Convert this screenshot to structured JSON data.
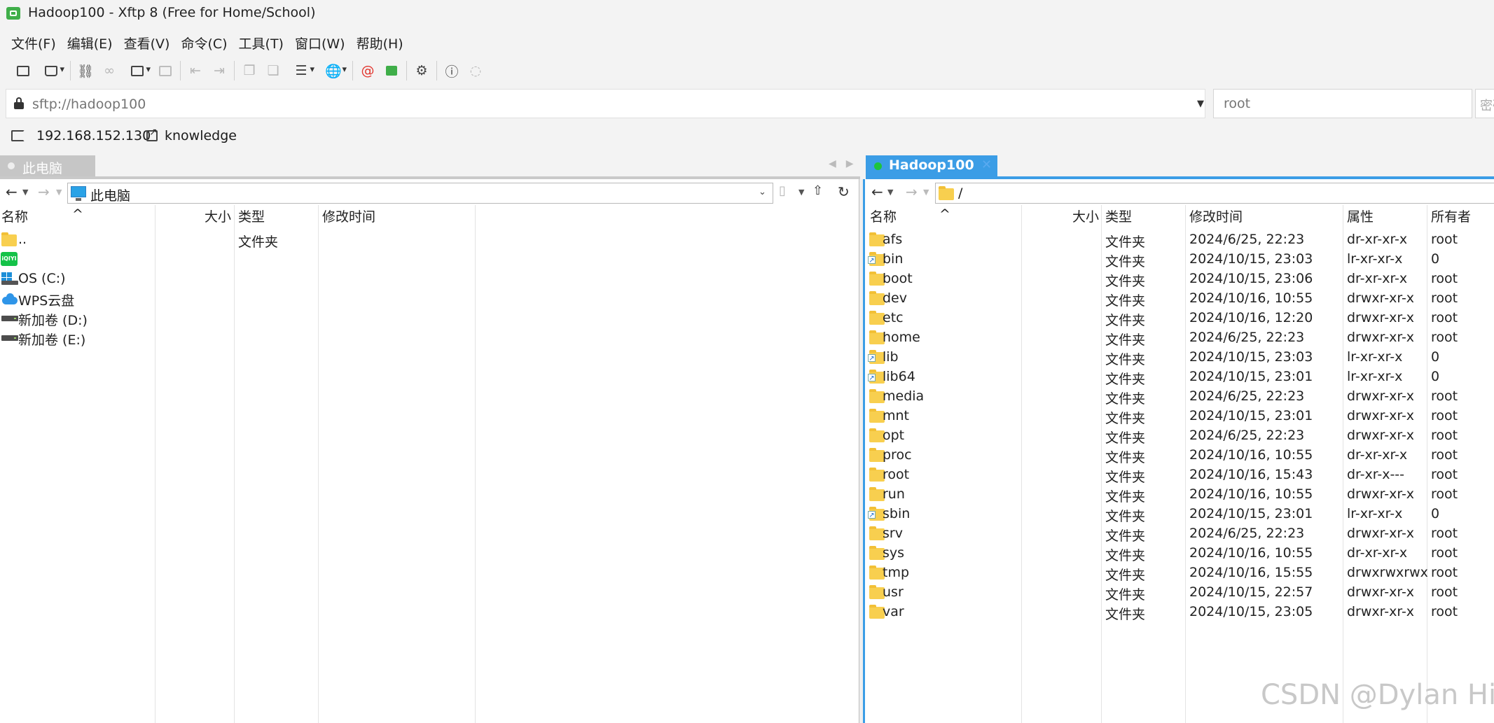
{
  "window": {
    "title": "Hadoop100 - Xftp 8 (Free for Home/School)"
  },
  "menu": [
    "文件(F)",
    "编辑(E)",
    "查看(V)",
    "命令(C)",
    "工具(T)",
    "窗口(W)",
    "帮助(H)"
  ],
  "address": {
    "url": "sftp://hadoop100",
    "username": "root",
    "password_placeholder": "密码"
  },
  "link_bar": {
    "host": "192.168.152.130",
    "session": "knowledge"
  },
  "tabs": {
    "left": "此电脑",
    "right": "Hadoop100"
  },
  "left_pane": {
    "path": "此电脑",
    "columns": [
      "名称",
      "大小",
      "类型",
      "修改时间"
    ],
    "rows": [
      {
        "name": "..",
        "type": "文件夹",
        "icon": "folder-icon"
      },
      {
        "name": "",
        "type": "",
        "icon": "iqiyi-icon"
      },
      {
        "name": "OS (C:)",
        "type": "",
        "icon": "windows-drive-icon"
      },
      {
        "name": "WPS云盘",
        "type": "",
        "icon": "cloud-icon"
      },
      {
        "name": "新加卷 (D:)",
        "type": "",
        "icon": "drive-icon"
      },
      {
        "name": "新加卷 (E:)",
        "type": "",
        "icon": "drive-icon"
      }
    ]
  },
  "right_pane": {
    "path": "/",
    "columns": [
      "名称",
      "大小",
      "类型",
      "修改时间",
      "属性",
      "所有者"
    ],
    "rows": [
      {
        "name": "afs",
        "type": "文件夹",
        "modified": "2024/6/25, 22:23",
        "attr": "dr-xr-xr-x",
        "owner": "root",
        "link": false
      },
      {
        "name": "bin",
        "type": "文件夹",
        "modified": "2024/10/15, 23:03",
        "attr": "lr-xr-xr-x",
        "owner": "0",
        "link": true
      },
      {
        "name": "boot",
        "type": "文件夹",
        "modified": "2024/10/15, 23:06",
        "attr": "dr-xr-xr-x",
        "owner": "root",
        "link": false
      },
      {
        "name": "dev",
        "type": "文件夹",
        "modified": "2024/10/16, 10:55",
        "attr": "drwxr-xr-x",
        "owner": "root",
        "link": false
      },
      {
        "name": "etc",
        "type": "文件夹",
        "modified": "2024/10/16, 12:20",
        "attr": "drwxr-xr-x",
        "owner": "root",
        "link": false
      },
      {
        "name": "home",
        "type": "文件夹",
        "modified": "2024/6/25, 22:23",
        "attr": "drwxr-xr-x",
        "owner": "root",
        "link": false
      },
      {
        "name": "lib",
        "type": "文件夹",
        "modified": "2024/10/15, 23:03",
        "attr": "lr-xr-xr-x",
        "owner": "0",
        "link": true
      },
      {
        "name": "lib64",
        "type": "文件夹",
        "modified": "2024/10/15, 23:01",
        "attr": "lr-xr-xr-x",
        "owner": "0",
        "link": true
      },
      {
        "name": "media",
        "type": "文件夹",
        "modified": "2024/6/25, 22:23",
        "attr": "drwxr-xr-x",
        "owner": "root",
        "link": false
      },
      {
        "name": "mnt",
        "type": "文件夹",
        "modified": "2024/10/15, 23:01",
        "attr": "drwxr-xr-x",
        "owner": "root",
        "link": false
      },
      {
        "name": "opt",
        "type": "文件夹",
        "modified": "2024/6/25, 22:23",
        "attr": "drwxr-xr-x",
        "owner": "root",
        "link": false
      },
      {
        "name": "proc",
        "type": "文件夹",
        "modified": "2024/10/16, 10:55",
        "attr": "dr-xr-xr-x",
        "owner": "root",
        "link": false
      },
      {
        "name": "root",
        "type": "文件夹",
        "modified": "2024/10/16, 15:43",
        "attr": "dr-xr-x---",
        "owner": "root",
        "link": false
      },
      {
        "name": "run",
        "type": "文件夹",
        "modified": "2024/10/16, 10:55",
        "attr": "drwxr-xr-x",
        "owner": "root",
        "link": false
      },
      {
        "name": "sbin",
        "type": "文件夹",
        "modified": "2024/10/15, 23:01",
        "attr": "lr-xr-xr-x",
        "owner": "0",
        "link": true
      },
      {
        "name": "srv",
        "type": "文件夹",
        "modified": "2024/6/25, 22:23",
        "attr": "drwxr-xr-x",
        "owner": "root",
        "link": false
      },
      {
        "name": "sys",
        "type": "文件夹",
        "modified": "2024/10/16, 10:55",
        "attr": "dr-xr-xr-x",
        "owner": "root",
        "link": false
      },
      {
        "name": "tmp",
        "type": "文件夹",
        "modified": "2024/10/16, 15:55",
        "attr": "drwxrwxrwx",
        "owner": "root",
        "link": false
      },
      {
        "name": "usr",
        "type": "文件夹",
        "modified": "2024/10/15, 22:57",
        "attr": "drwxr-xr-x",
        "owner": "root",
        "link": false
      },
      {
        "name": "var",
        "type": "文件夹",
        "modified": "2024/10/15, 23:05",
        "attr": "drwxr-xr-x",
        "owner": "root",
        "link": false
      }
    ]
  },
  "watermark": "CSDN @Dylan Hill",
  "colors": {
    "accent": "#3b9de6",
    "connected": "#1ec43c",
    "folder": "#f8cf4f"
  }
}
